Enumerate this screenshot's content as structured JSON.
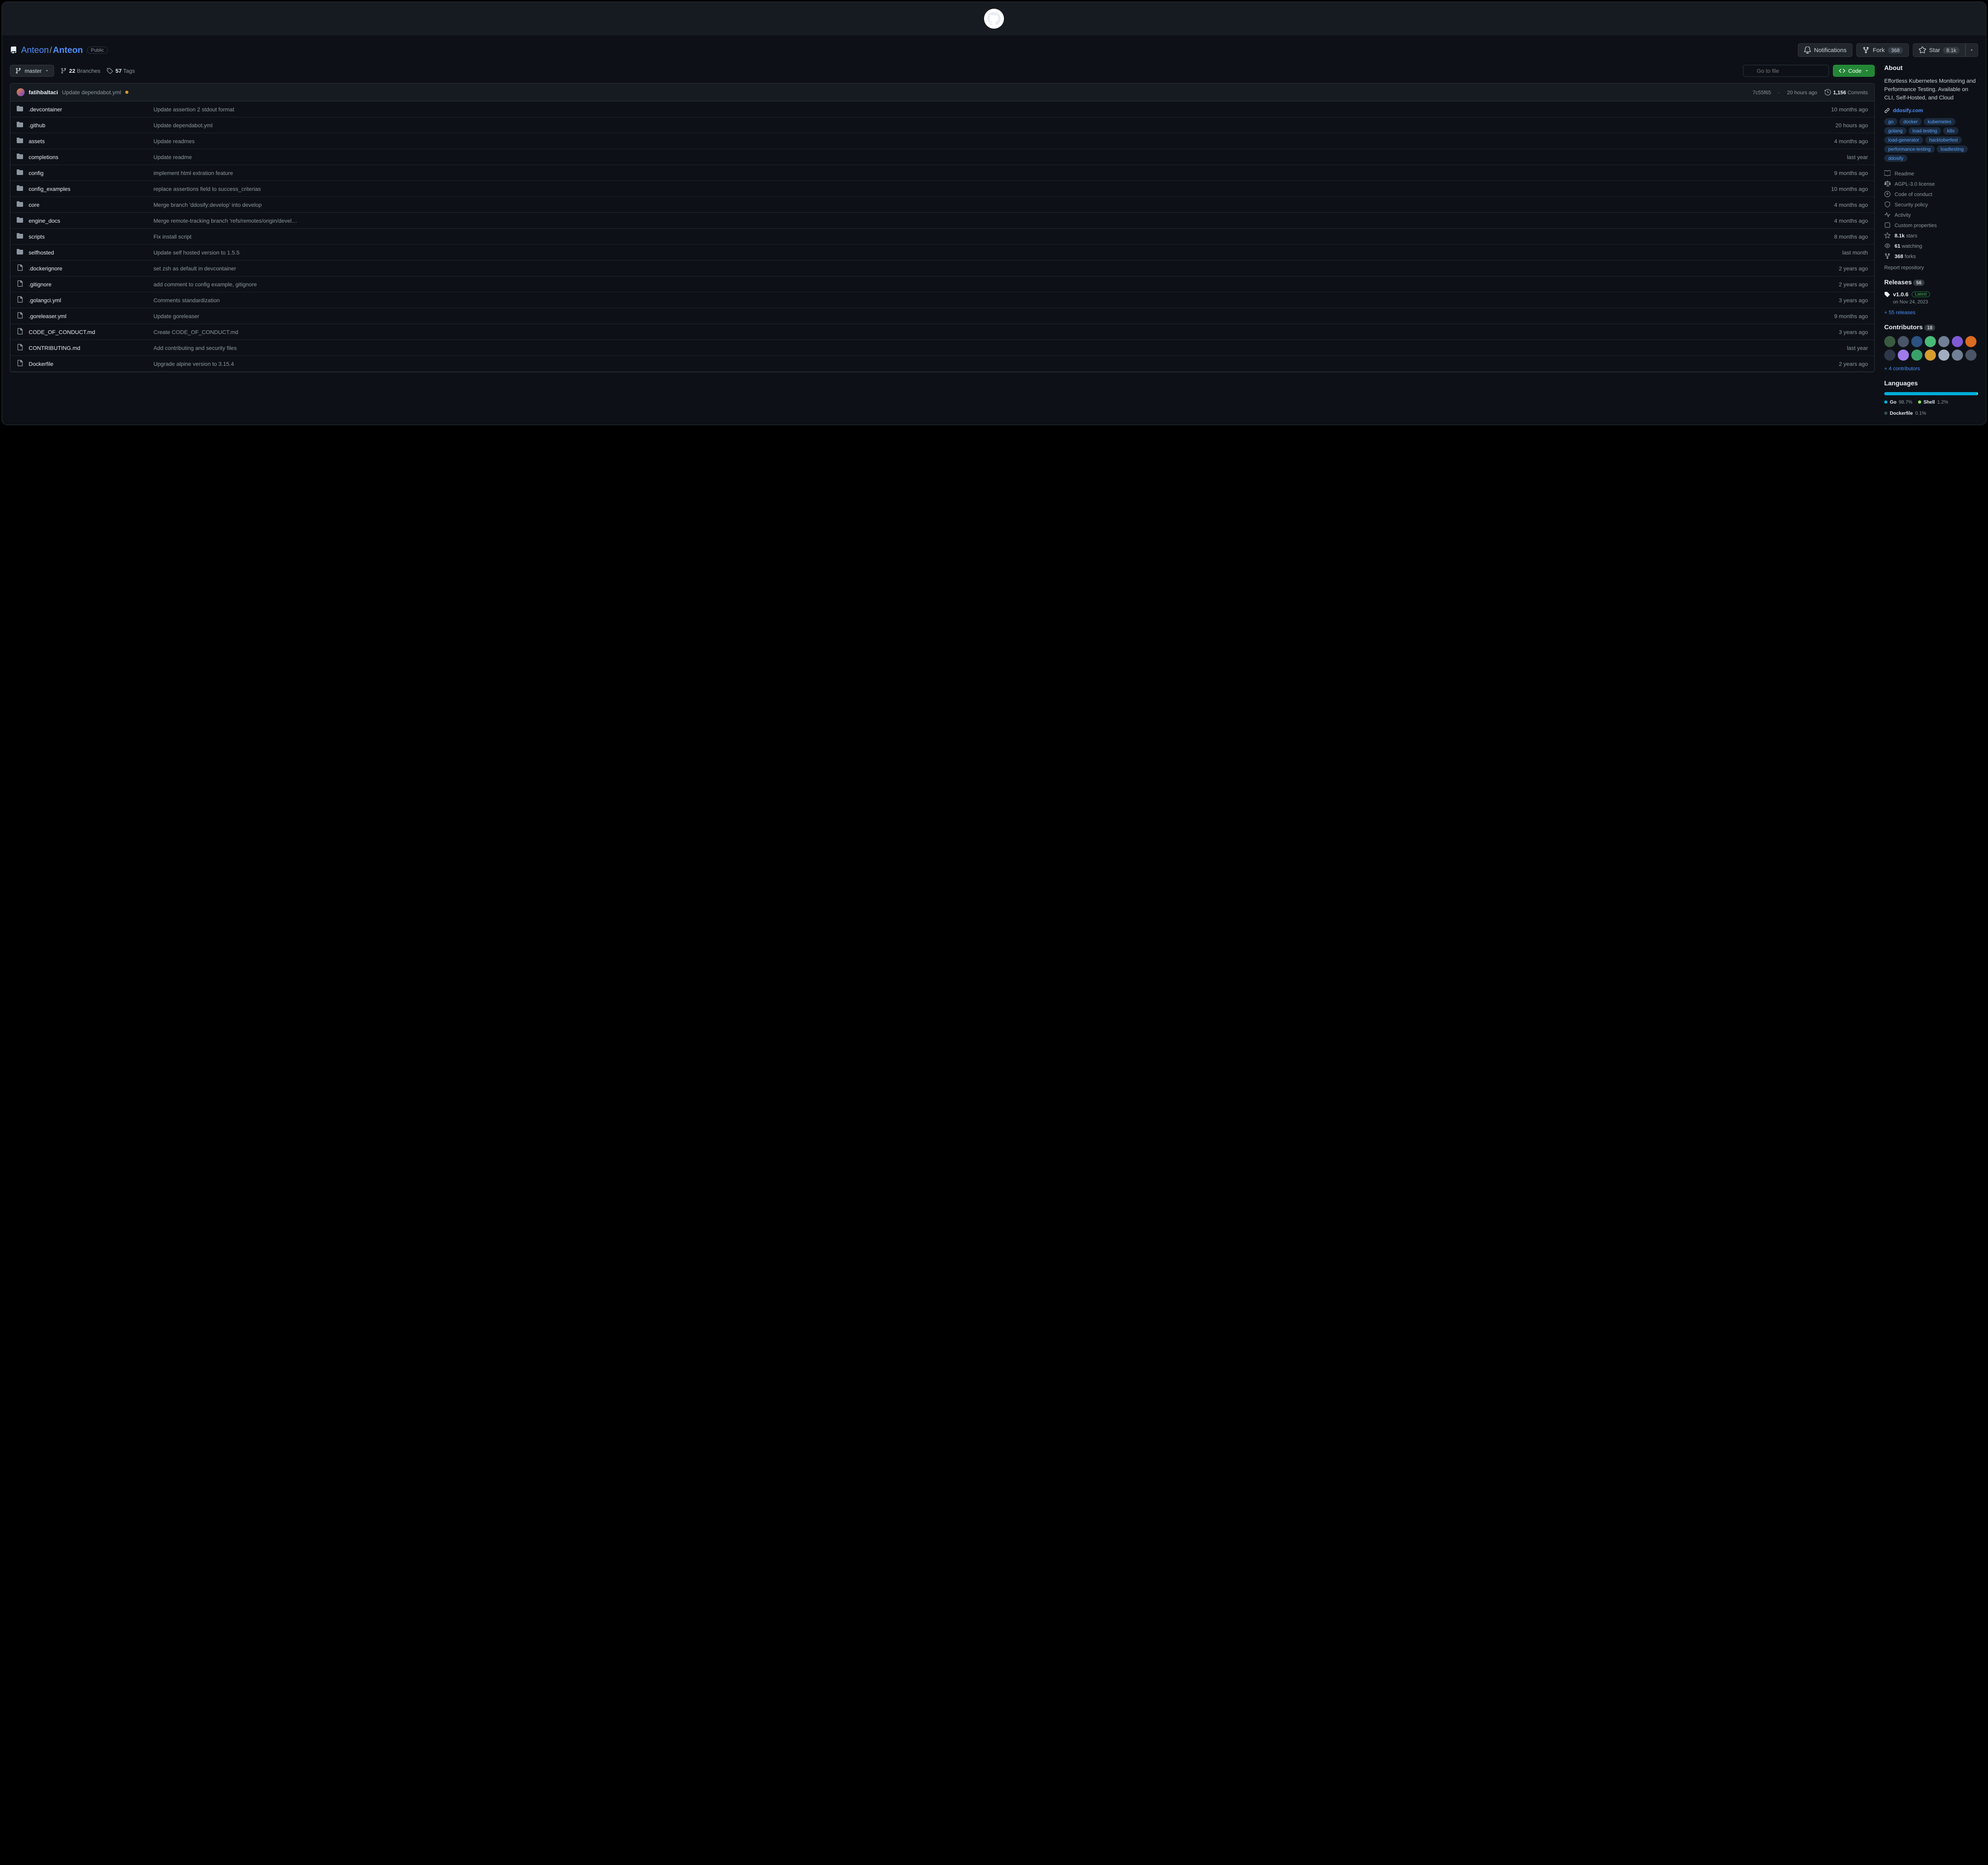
{
  "repo": {
    "owner": "Anteon",
    "name": "Anteon",
    "visibility": "Public"
  },
  "actions": {
    "notifications": "Notifications",
    "fork": "Fork",
    "fork_count": "368",
    "star": "Star",
    "star_count": "8.1k"
  },
  "codebar": {
    "branch": "master",
    "branches_count": "22",
    "branches_label": "Branches",
    "tags_count": "57",
    "tags_label": "Tags",
    "search_placeholder": "Go to file",
    "code_button": "Code"
  },
  "commit": {
    "author": "fatihbaltaci",
    "message": "Update dependabot.yml",
    "sha": "7c55f65",
    "time": "20 hours ago",
    "commits_count": "1,156",
    "commits_label": "Commits"
  },
  "files": [
    {
      "type": "dir",
      "name": ".devcontainer",
      "msg": "Update assertion 2 stdout format",
      "time": "10 months ago"
    },
    {
      "type": "dir",
      "name": ".github",
      "msg": "Update dependabot.yml",
      "time": "20 hours ago"
    },
    {
      "type": "dir",
      "name": "assets",
      "msg": "Update readmes",
      "time": "4 months ago"
    },
    {
      "type": "dir",
      "name": "completions",
      "msg": "Update readme",
      "time": "last year"
    },
    {
      "type": "dir",
      "name": "config",
      "msg": "implement html extration feature",
      "time": "9 months ago"
    },
    {
      "type": "dir",
      "name": "config_examples",
      "msg": "replace assertions field to success_criterias",
      "time": "10 months ago"
    },
    {
      "type": "dir",
      "name": "core",
      "msg": "Merge branch 'ddosify:develop' into develop",
      "time": "4 months ago"
    },
    {
      "type": "dir",
      "name": "engine_docs",
      "msg": "Merge remote-tracking branch 'refs/remotes/origin/devel…",
      "time": "4 months ago"
    },
    {
      "type": "dir",
      "name": "scripts",
      "msg": "Fix install script",
      "time": "8 months ago"
    },
    {
      "type": "dir",
      "name": "selfhosted",
      "msg": "Update self hosted version to 1.5.5",
      "time": "last month"
    },
    {
      "type": "file",
      "name": ".dockerignore",
      "msg": "set zsh as default in devcontainer",
      "time": "2 years ago"
    },
    {
      "type": "file",
      "name": ".gitignore",
      "msg": "add comment to config example, gitignore",
      "time": "2 years ago"
    },
    {
      "type": "file",
      "name": ".golangci.yml",
      "msg": "Comments standardization",
      "time": "3 years ago"
    },
    {
      "type": "file",
      "name": ".goreleaser.yml",
      "msg": "Update goreleaser",
      "time": "9 months ago"
    },
    {
      "type": "file",
      "name": "CODE_OF_CONDUCT.md",
      "msg": "Create CODE_OF_CONDUCT.md",
      "time": "3 years ago"
    },
    {
      "type": "file",
      "name": "CONTRIBUTING.md",
      "msg": "Add contributing and security files",
      "time": "last year"
    },
    {
      "type": "file",
      "name": "Dockerfile",
      "msg": "Upgrade alpine version to 3.15.4",
      "time": "2 years ago"
    }
  ],
  "about": {
    "heading": "About",
    "description": "Effortless Kubernetes Monitoring and Performance Testing. Available on CLI, Self-Hosted, and Cloud",
    "website": "ddosify.com",
    "topics": [
      "go",
      "docker",
      "kubernetes",
      "golang",
      "load-testing",
      "k8s",
      "load-generator",
      "hacktoberfest",
      "performance-testing",
      "loadtesting",
      "ddosify"
    ],
    "meta": {
      "readme": "Readme",
      "license": "AGPL-3.0 license",
      "conduct": "Code of conduct",
      "security": "Security policy",
      "activity": "Activity",
      "custom": "Custom properties",
      "stars_count": "8.1k",
      "stars_label": "stars",
      "watching_count": "61",
      "watching_label": "watching",
      "forks_count": "368",
      "forks_label": "forks"
    },
    "report": "Report repository"
  },
  "releases": {
    "heading": "Releases",
    "count": "56",
    "tag": "v1.0.6",
    "latest": "Latest",
    "date": "on Nov 24, 2023",
    "more": "+ 55 releases"
  },
  "contributors": {
    "heading": "Contributors",
    "count": "18",
    "avatar_colors": [
      "#3a5a40",
      "#4a5568",
      "#2c5282",
      "#48bb78",
      "#718096",
      "#805ad5",
      "#dd6b20",
      "#2d3748",
      "#9f7aea",
      "#38a169",
      "#d69e2e",
      "#a0aec0",
      "#718096",
      "#4a5568"
    ],
    "more": "+ 4 contributors"
  },
  "languages": {
    "heading": "Languages",
    "items": [
      {
        "name": "Go",
        "pct": "98.7%",
        "color": "#00ADD8"
      },
      {
        "name": "Shell",
        "pct": "1.2%",
        "color": "#89e051"
      },
      {
        "name": "Dockerfile",
        "pct": "0.1%",
        "color": "#384d54"
      }
    ]
  }
}
